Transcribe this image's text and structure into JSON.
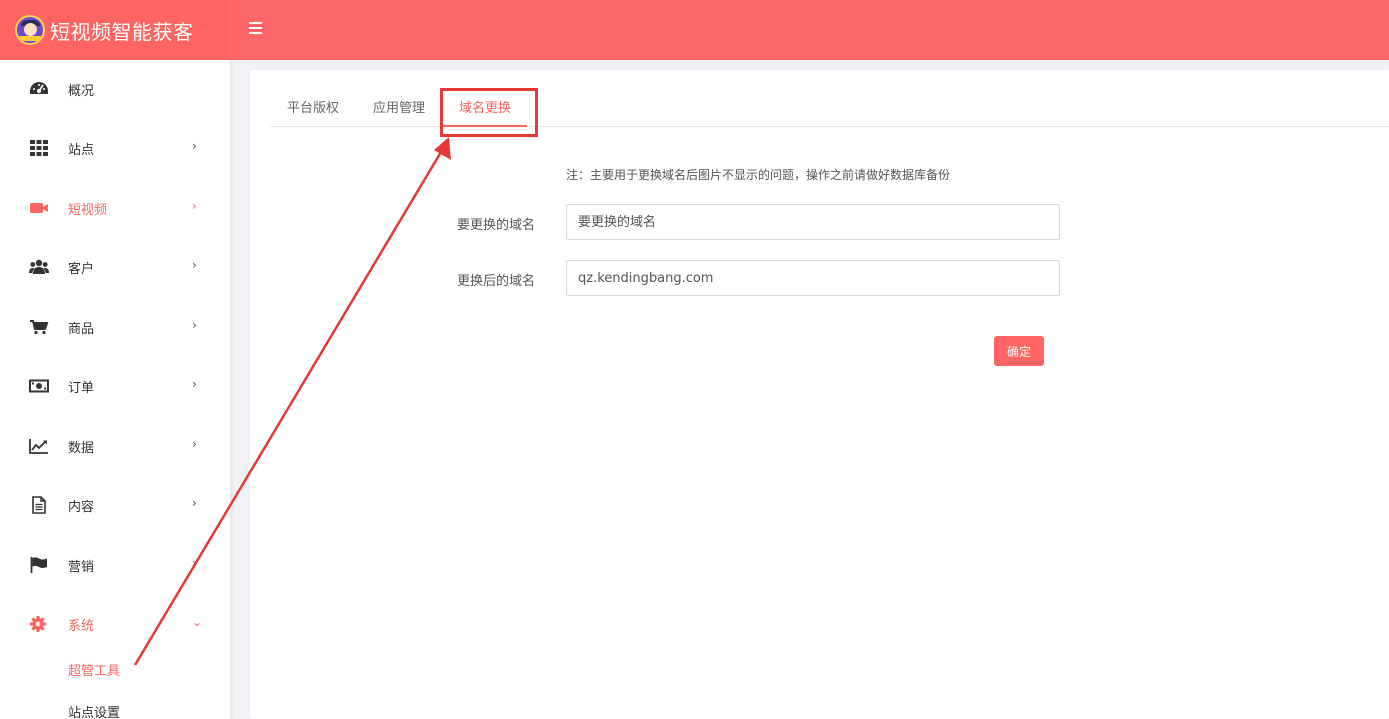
{
  "header": {
    "app_title": "短视频智能获客",
    "colors": {
      "brand": "#fe6562",
      "header": "#ff6866"
    }
  },
  "sidebar": {
    "items": [
      {
        "label": "概况",
        "icon": "dashboard-icon",
        "has_arrow": false
      },
      {
        "label": "站点",
        "icon": "grid-icon",
        "arrow": "›"
      },
      {
        "label": "短视频",
        "icon": "video-camera-icon",
        "arrow": "›",
        "active": true
      },
      {
        "label": "客户",
        "icon": "users-icon",
        "arrow": "›"
      },
      {
        "label": "商品",
        "icon": "cart-icon",
        "arrow": "›"
      },
      {
        "label": "订单",
        "icon": "money-icon",
        "arrow": "›"
      },
      {
        "label": "数据",
        "icon": "line-chart-icon",
        "arrow": "›"
      },
      {
        "label": "内容",
        "icon": "document-icon",
        "arrow": "›"
      },
      {
        "label": "营销",
        "icon": "flag-icon",
        "arrow": "›"
      },
      {
        "label": "系统",
        "icon": "gear-icon",
        "arrow": "⌄",
        "active": true
      }
    ],
    "sub_items": [
      {
        "label": "超管工具",
        "active": true
      },
      {
        "label": "站点设置"
      }
    ]
  },
  "tabs": [
    {
      "label": "平台版权"
    },
    {
      "label": "应用管理"
    },
    {
      "label": "域名更换",
      "active": true
    }
  ],
  "form": {
    "note": "注：主要用于更换域名后图片不显示的问题，操作之前请做好数据库备份",
    "old_domain": {
      "label": "要更换的域名",
      "placeholder": "要更换的域名",
      "value": ""
    },
    "new_domain": {
      "label": "更换后的域名",
      "value": "qz.kendingbang.com"
    },
    "submit_label": "确定"
  }
}
